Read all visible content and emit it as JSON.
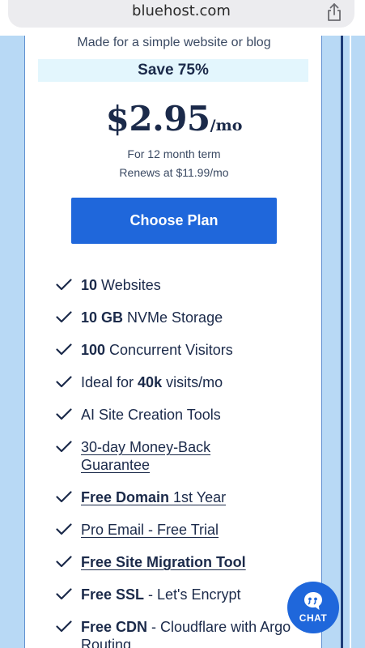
{
  "browser": {
    "url": "bluehost.com",
    "share_icon": "share-icon"
  },
  "plan": {
    "tagline": "Made for a simple website or blog",
    "save_badge": "Save 75%",
    "price": "$2.95",
    "price_unit": "/mo",
    "term": "For 12 month term",
    "renewal": "Renews at $11.99/mo",
    "cta_label": "Choose Plan"
  },
  "features": [
    {
      "bold": "10",
      "text": " Websites"
    },
    {
      "bold": "10 GB",
      "text": " NVMe Storage"
    },
    {
      "bold": "100",
      "text": " Concurrent Visitors"
    },
    {
      "pre": "Ideal for ",
      "bold": "40k",
      "text": " visits/mo"
    },
    {
      "text": "AI Site Creation Tools"
    },
    {
      "link": "30-day Money-Back Guarantee"
    },
    {
      "link_bold": "Free Domain",
      "link": " 1st Year"
    },
    {
      "link": "Pro Email - Free Trial"
    },
    {
      "link_bold": "Free Site Migration Tool"
    },
    {
      "bold": "Free SSL",
      "text": " - Let's Encrypt"
    },
    {
      "bold": "Free CDN",
      "text": " - Cloudflare with Argo Routing"
    }
  ],
  "chat": {
    "label": "CHAT",
    "icon": "chat-bubble-icon"
  },
  "colors": {
    "accent": "#1f67db",
    "text_dark": "#1b2a4a",
    "banner_bg": "#e3f6fd",
    "page_bg": "#b8d9f5"
  }
}
